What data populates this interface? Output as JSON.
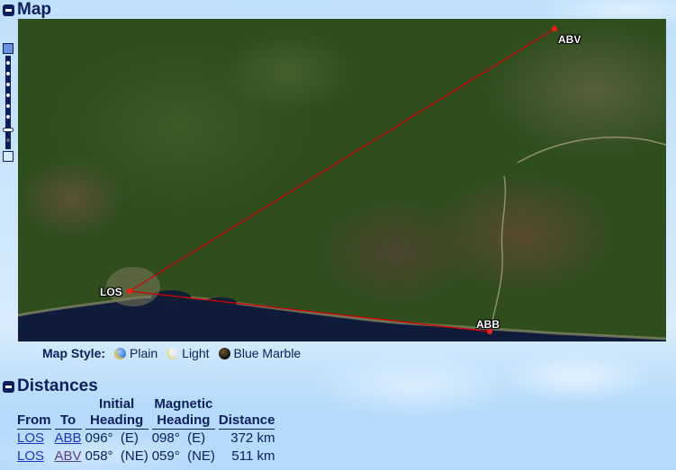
{
  "map_section": {
    "title": "Map",
    "airports": [
      {
        "code": "LOS"
      },
      {
        "code": "ABB"
      },
      {
        "code": "ABV"
      }
    ],
    "routes": [
      {
        "from": "LOS",
        "to": "ABB"
      },
      {
        "from": "LOS",
        "to": "ABV"
      }
    ],
    "route_color": "#d40000",
    "map_style": {
      "label": "Map Style:",
      "options": [
        {
          "label": "Plain",
          "icon": "globe-plain-icon"
        },
        {
          "label": "Light",
          "icon": "globe-light-icon"
        },
        {
          "label": "Blue Marble",
          "icon": "globe-blue-marble-icon"
        }
      ]
    }
  },
  "distances_section": {
    "title": "Distances",
    "headers": {
      "from": "From",
      "to": "To",
      "initial_top": "Initial",
      "initial_bottom": "Heading",
      "magnetic_top": "Magnetic",
      "magnetic_bottom": "Heading",
      "distance": "Distance"
    },
    "rows": [
      {
        "from": "LOS",
        "to": "ABB",
        "initial": "096°  (E)",
        "magnetic": "098°  (E)",
        "distance": "372 km"
      },
      {
        "from": "LOS",
        "to": "ABV",
        "initial": "058°  (NE)",
        "magnetic": "059°  (NE)",
        "distance": "511 km"
      }
    ]
  }
}
